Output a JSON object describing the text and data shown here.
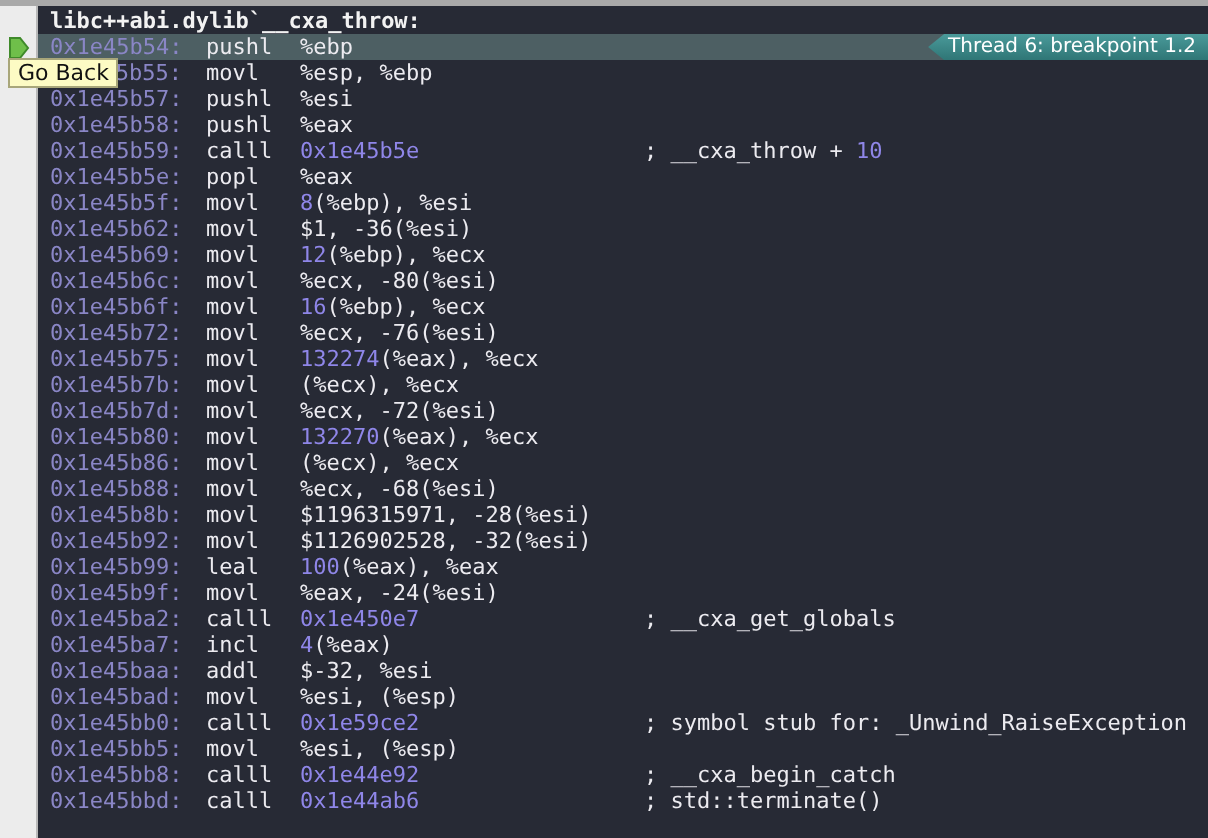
{
  "title": "libc++abi.dylib`__cxa_throw:",
  "tooltip": "Go Back",
  "breakpoint": {
    "label": "Thread 6: breakpoint 1.2"
  },
  "rows": [
    {
      "address": "0x1e45b54:",
      "mnemonic": "pushl",
      "operand": [
        {
          "text": "%ebp",
          "kind": "plain"
        }
      ],
      "current": true
    },
    {
      "address": "5b55:",
      "mnemonic": "movl",
      "operand": [
        {
          "text": "%esp, %ebp",
          "kind": "plain"
        }
      ],
      "current": false
    },
    {
      "address": "0x1e45b57:",
      "mnemonic": "pushl",
      "operand": [
        {
          "text": "%esi",
          "kind": "plain"
        }
      ],
      "current": false
    },
    {
      "address": "0x1e45b58:",
      "mnemonic": "pushl",
      "operand": [
        {
          "text": "%eax",
          "kind": "plain"
        }
      ],
      "current": false
    },
    {
      "address": "0x1e45b59:",
      "mnemonic": "calll",
      "operand": [
        {
          "text": "0x1e45b5e",
          "kind": "num"
        }
      ],
      "comment": [
        {
          "text": "; __cxa_throw + ",
          "kind": "plain"
        },
        {
          "text": "10",
          "kind": "num"
        }
      ],
      "current": false
    },
    {
      "address": "0x1e45b5e:",
      "mnemonic": "popl",
      "operand": [
        {
          "text": "%eax",
          "kind": "plain"
        }
      ],
      "current": false
    },
    {
      "address": "0x1e45b5f:",
      "mnemonic": "movl",
      "operand": [
        {
          "text": "8",
          "kind": "num"
        },
        {
          "text": "(%ebp), %esi",
          "kind": "plain"
        }
      ],
      "current": false
    },
    {
      "address": "0x1e45b62:",
      "mnemonic": "movl",
      "operand": [
        {
          "text": "$1, -36(%esi)",
          "kind": "plain"
        }
      ],
      "current": false
    },
    {
      "address": "0x1e45b69:",
      "mnemonic": "movl",
      "operand": [
        {
          "text": "12",
          "kind": "num"
        },
        {
          "text": "(%ebp), %ecx",
          "kind": "plain"
        }
      ],
      "current": false
    },
    {
      "address": "0x1e45b6c:",
      "mnemonic": "movl",
      "operand": [
        {
          "text": "%ecx, -80(%esi)",
          "kind": "plain"
        }
      ],
      "current": false
    },
    {
      "address": "0x1e45b6f:",
      "mnemonic": "movl",
      "operand": [
        {
          "text": "16",
          "kind": "num"
        },
        {
          "text": "(%ebp), %ecx",
          "kind": "plain"
        }
      ],
      "current": false
    },
    {
      "address": "0x1e45b72:",
      "mnemonic": "movl",
      "operand": [
        {
          "text": "%ecx, -76(%esi)",
          "kind": "plain"
        }
      ],
      "current": false
    },
    {
      "address": "0x1e45b75:",
      "mnemonic": "movl",
      "operand": [
        {
          "text": "132274",
          "kind": "num"
        },
        {
          "text": "(%eax), %ecx",
          "kind": "plain"
        }
      ],
      "current": false
    },
    {
      "address": "0x1e45b7b:",
      "mnemonic": "movl",
      "operand": [
        {
          "text": "(%ecx), %ecx",
          "kind": "plain"
        }
      ],
      "current": false
    },
    {
      "address": "0x1e45b7d:",
      "mnemonic": "movl",
      "operand": [
        {
          "text": "%ecx, -72(%esi)",
          "kind": "plain"
        }
      ],
      "current": false
    },
    {
      "address": "0x1e45b80:",
      "mnemonic": "movl",
      "operand": [
        {
          "text": "132270",
          "kind": "num"
        },
        {
          "text": "(%eax), %ecx",
          "kind": "plain"
        }
      ],
      "current": false
    },
    {
      "address": "0x1e45b86:",
      "mnemonic": "movl",
      "operand": [
        {
          "text": "(%ecx), %ecx",
          "kind": "plain"
        }
      ],
      "current": false
    },
    {
      "address": "0x1e45b88:",
      "mnemonic": "movl",
      "operand": [
        {
          "text": "%ecx, -68(%esi)",
          "kind": "plain"
        }
      ],
      "current": false
    },
    {
      "address": "0x1e45b8b:",
      "mnemonic": "movl",
      "operand": [
        {
          "text": "$1196315971, -28(%esi)",
          "kind": "plain"
        }
      ],
      "current": false
    },
    {
      "address": "0x1e45b92:",
      "mnemonic": "movl",
      "operand": [
        {
          "text": "$1126902528, -32(%esi)",
          "kind": "plain"
        }
      ],
      "current": false
    },
    {
      "address": "0x1e45b99:",
      "mnemonic": "leal",
      "operand": [
        {
          "text": "100",
          "kind": "num"
        },
        {
          "text": "(%eax), %eax",
          "kind": "plain"
        }
      ],
      "current": false
    },
    {
      "address": "0x1e45b9f:",
      "mnemonic": "movl",
      "operand": [
        {
          "text": "%eax, -24(%esi)",
          "kind": "plain"
        }
      ],
      "current": false
    },
    {
      "address": "0x1e45ba2:",
      "mnemonic": "calll",
      "operand": [
        {
          "text": "0x1e450e7",
          "kind": "num"
        }
      ],
      "comment": [
        {
          "text": "; __cxa_get_globals",
          "kind": "plain"
        }
      ],
      "current": false
    },
    {
      "address": "0x1e45ba7:",
      "mnemonic": "incl",
      "operand": [
        {
          "text": "4",
          "kind": "num"
        },
        {
          "text": "(%eax)",
          "kind": "plain"
        }
      ],
      "current": false
    },
    {
      "address": "0x1e45baa:",
      "mnemonic": "addl",
      "operand": [
        {
          "text": "$-32, %esi",
          "kind": "plain"
        }
      ],
      "current": false
    },
    {
      "address": "0x1e45bad:",
      "mnemonic": "movl",
      "operand": [
        {
          "text": "%esi, (%esp)",
          "kind": "plain"
        }
      ],
      "current": false
    },
    {
      "address": "0x1e45bb0:",
      "mnemonic": "calll",
      "operand": [
        {
          "text": "0x1e59ce2",
          "kind": "num"
        }
      ],
      "comment": [
        {
          "text": "; symbol stub for: _Unwind_RaiseException",
          "kind": "plain"
        }
      ],
      "current": false
    },
    {
      "address": "0x1e45bb5:",
      "mnemonic": "movl",
      "operand": [
        {
          "text": "%esi, (%esp)",
          "kind": "plain"
        }
      ],
      "current": false
    },
    {
      "address": "0x1e45bb8:",
      "mnemonic": "calll",
      "operand": [
        {
          "text": "0x1e44e92",
          "kind": "num"
        }
      ],
      "comment": [
        {
          "text": "; __cxa_begin_catch",
          "kind": "plain"
        }
      ],
      "current": false
    },
    {
      "address": "0x1e45bbd:",
      "mnemonic": "calll",
      "operand": [
        {
          "text": "0x1e44ab6",
          "kind": "num"
        }
      ],
      "comment": [
        {
          "text": "; std::terminate()",
          "kind": "plain"
        }
      ],
      "current": false
    }
  ]
}
